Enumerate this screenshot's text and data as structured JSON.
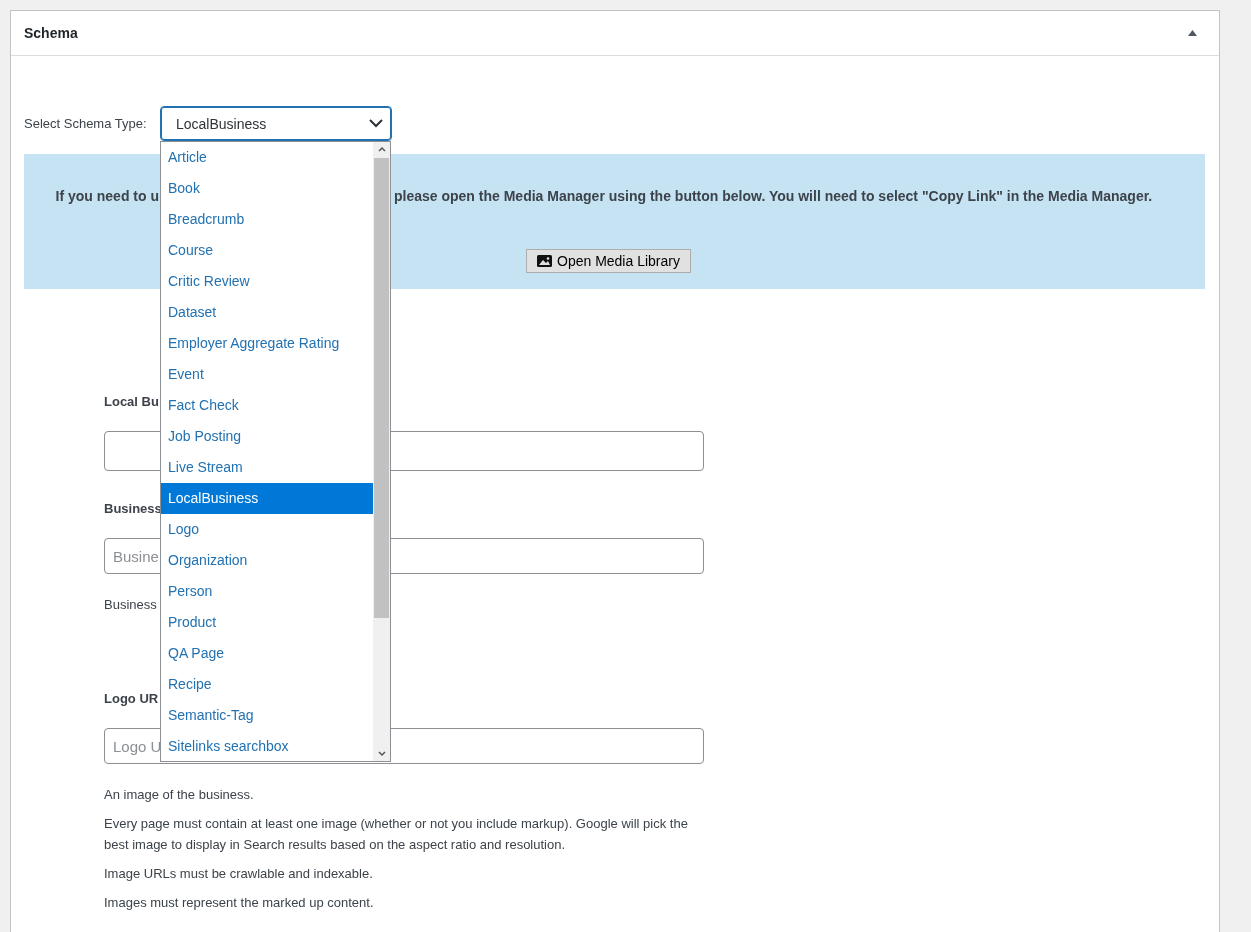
{
  "panel": {
    "title": "Schema"
  },
  "schema_select": {
    "label": "Select Schema Type:",
    "value": "LocalBusiness",
    "expanded": true,
    "options": [
      {
        "label": "Article",
        "selected": false
      },
      {
        "label": "Book",
        "selected": false
      },
      {
        "label": "Breadcrumb",
        "selected": false
      },
      {
        "label": "Course",
        "selected": false
      },
      {
        "label": "Critic Review",
        "selected": false
      },
      {
        "label": "Dataset",
        "selected": false
      },
      {
        "label": "Employer Aggregate Rating",
        "selected": false
      },
      {
        "label": "Event",
        "selected": false
      },
      {
        "label": "Fact Check",
        "selected": false
      },
      {
        "label": "Job Posting",
        "selected": false
      },
      {
        "label": "Live Stream",
        "selected": false
      },
      {
        "label": "LocalBusiness",
        "selected": true
      },
      {
        "label": "Logo",
        "selected": false
      },
      {
        "label": "Organization",
        "selected": false
      },
      {
        "label": "Person",
        "selected": false
      },
      {
        "label": "Product",
        "selected": false
      },
      {
        "label": "QA Page",
        "selected": false
      },
      {
        "label": "Recipe",
        "selected": false
      },
      {
        "label": "Semantic-Tag",
        "selected": false
      },
      {
        "label": "Sitelinks searchbox",
        "selected": false
      }
    ]
  },
  "notice": {
    "text_before": "If you need to u",
    "text_after": "please open the Media Manager using the button below. You will need to select \"Copy Link\" in the Media Manager.",
    "button": "Open Media Library"
  },
  "fields": [
    {
      "label": "Local Bu"
    },
    {
      "label": "Business",
      "placeholder": "Busine",
      "help": [
        "Business"
      ]
    },
    {
      "label": "Logo UR",
      "placeholder": "Logo U",
      "help": [
        "An image of the business.",
        "Every page must contain at least one image (whether or not you include markup). Google will pick the best image to display in Search results based on the aspect ratio and resolution.",
        "Image URLs must be crawlable and indexable.",
        "Images must represent the marked up content."
      ]
    }
  ]
}
